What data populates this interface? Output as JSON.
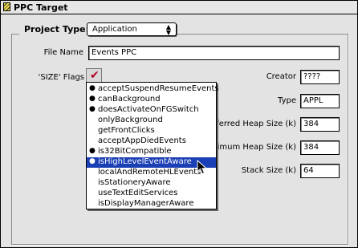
{
  "window": {
    "title": "PPC Target"
  },
  "project": {
    "label": "Project Type:",
    "type_value": "Application"
  },
  "file": {
    "label": "File Name",
    "value": "Events PPC"
  },
  "flags": {
    "label": "'SIZE' Flags"
  },
  "creator": {
    "label": "Creator",
    "value": "????"
  },
  "type": {
    "label": "Type",
    "value": "APPL"
  },
  "pref_heap": {
    "label": "ferred Heap Size (k)",
    "value": "384"
  },
  "min_heap": {
    "label": "imum Heap Size (k)",
    "value": "384"
  },
  "stack": {
    "label": "Stack Size (k)",
    "value": "64"
  },
  "menu": {
    "items": [
      {
        "label": "acceptSuspendResumeEvents",
        "checked": true
      },
      {
        "label": "canBackground",
        "checked": true
      },
      {
        "label": "doesActivateOnFGSwitch",
        "checked": true
      },
      {
        "label": "onlyBackground",
        "checked": false
      },
      {
        "label": "getFrontClicks",
        "checked": false
      },
      {
        "label": "acceptAppDiedEvents",
        "checked": false
      },
      {
        "label": "is32BitCompatible",
        "checked": true
      },
      {
        "label": "isHighLevelEventAware",
        "checked": true,
        "selected": true
      },
      {
        "label": "localAndRemoteHLEvents",
        "checked": false
      },
      {
        "label": "isStationeryAware",
        "checked": false
      },
      {
        "label": "useTextEditServices",
        "checked": false
      },
      {
        "label": "isDisplayManagerAware",
        "checked": false
      }
    ]
  },
  "colors": {
    "selection": "#1b3fb5",
    "check": "#b2001f"
  }
}
